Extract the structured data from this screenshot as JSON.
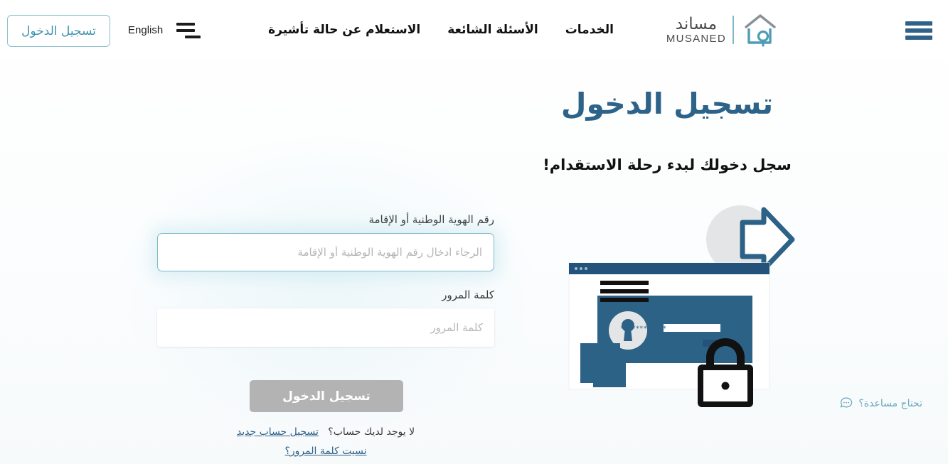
{
  "header": {
    "login_button": "تسجيل الدخول",
    "language_label": "English",
    "nav_items": [
      {
        "label": "الخدمات",
        "name": "nav-services"
      },
      {
        "label": "الأسئلة الشائعة",
        "name": "nav-faq"
      },
      {
        "label": "الاستعلام عن حالة تأشيرة",
        "name": "nav-visa-status"
      }
    ],
    "logo": {
      "arabic": "مساند",
      "english": "MUSANED"
    },
    "menu_icon": "hamburger-icon",
    "language_icon": "language-toggle-icon"
  },
  "hero": {
    "title": "تسجيل الدخول",
    "subtitle": "سجل دخولك لبدء رحلة الاستقدام!"
  },
  "form": {
    "national_id": {
      "label": "رقم الهوية الوطنية أو الإقامة",
      "placeholder": "الرجاء ادخال رقم الهوية الوطنية أو الإقامة",
      "value": ""
    },
    "password": {
      "label": "كلمة المرور",
      "placeholder": "كلمة المرور",
      "value": ""
    },
    "submit_label": "تسجيل الدخول",
    "no_account_text": "لا يوجد لديك حساب؟",
    "signup_link": "تسجيل حساب جديد",
    "forgot_link": "نسيت كلمة المرور؟"
  },
  "help": {
    "label": "تحتاج مساعدة؟",
    "icon": "chat-bubble-icon"
  },
  "illustration": {
    "name": "login-security-illustration",
    "password_dots": "************"
  },
  "colors": {
    "heading_blue": "#2e6389",
    "accent_teal": "#3f93ad",
    "border_teal": "#7fb9ca",
    "disabled_gray": "#b3b3b3",
    "illustration_blue": "#2d6287",
    "illustration_dark": "#23537a",
    "circle_gray": "#e3e5e6"
  }
}
